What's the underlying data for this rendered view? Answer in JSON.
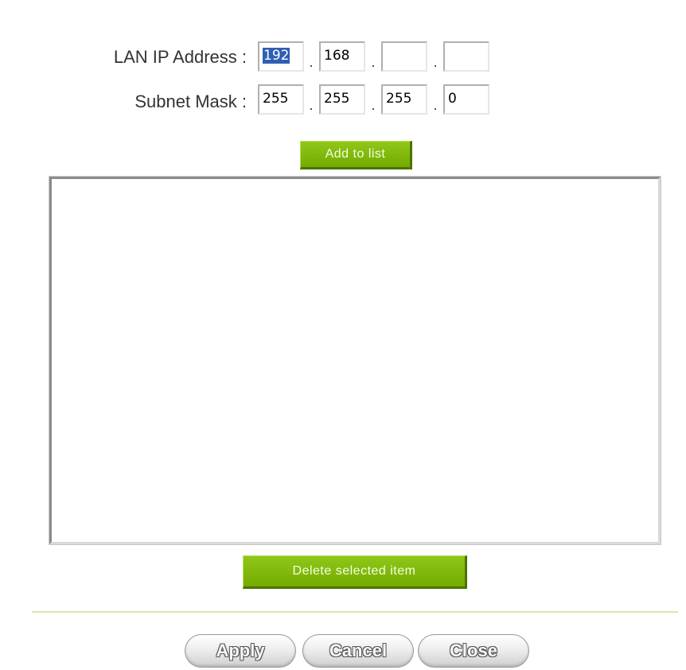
{
  "form": {
    "lan_ip": {
      "label": "LAN IP Address :",
      "octets": [
        "192",
        "168",
        "",
        ""
      ]
    },
    "subnet_mask": {
      "label": "Subnet Mask :",
      "octets": [
        "255",
        "255",
        "255",
        "0"
      ]
    },
    "separator": "."
  },
  "buttons": {
    "add_to_list": "Add to list",
    "delete_selected": "Delete selected item",
    "apply": "Apply",
    "cancel": "Cancel",
    "close": "Close"
  },
  "list": {
    "items": []
  },
  "colors": {
    "green_button": "#7ab800",
    "selection": "#2f5fb3",
    "divider": "#d8e6b0"
  }
}
